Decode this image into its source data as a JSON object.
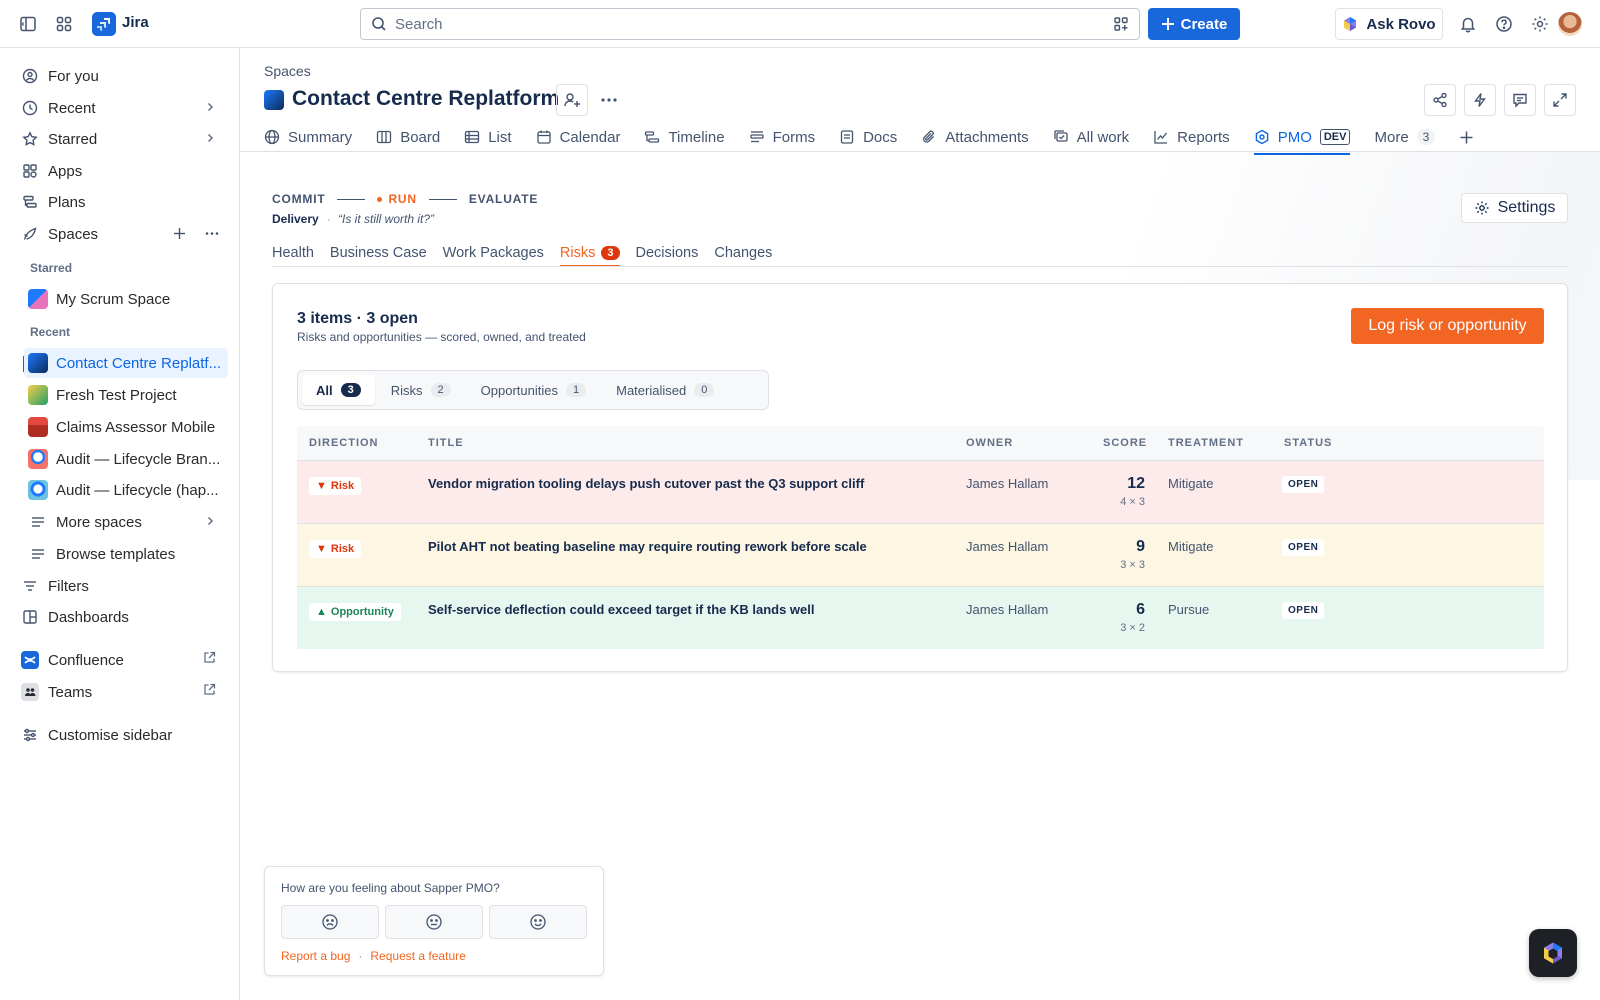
{
  "topbar": {
    "app_name": "Jira",
    "search_placeholder": "Search",
    "create_label": "Create",
    "ask_rovo_label": "Ask Rovo"
  },
  "sidebar": {
    "items": [
      {
        "label": "For you",
        "icon": "person-circle-icon"
      },
      {
        "label": "Recent",
        "icon": "clock-icon"
      },
      {
        "label": "Starred",
        "icon": "star-icon"
      },
      {
        "label": "Apps",
        "icon": "apps-icon"
      },
      {
        "label": "Plans",
        "icon": "plans-icon"
      },
      {
        "label": "Spaces",
        "icon": "spaces-icon"
      }
    ],
    "starred_heading": "Starred",
    "starred": [
      {
        "label": "My Scrum Space"
      }
    ],
    "recent_heading": "Recent",
    "recent": [
      {
        "label": "Contact Centre Replatf..."
      },
      {
        "label": "Fresh Test Project"
      },
      {
        "label": "Claims Assessor Mobile"
      },
      {
        "label": "Audit — Lifecycle Bran..."
      },
      {
        "label": "Audit — Lifecycle (hap..."
      }
    ],
    "more_spaces": "More spaces",
    "browse_templates": "Browse templates",
    "filters": "Filters",
    "dashboards": "Dashboards",
    "confluence": "Confluence",
    "teams": "Teams",
    "customise": "Customise sidebar"
  },
  "header": {
    "breadcrumb": "Spaces",
    "title": "Contact Centre Replatform"
  },
  "tabs": [
    {
      "label": "Summary",
      "icon": "globe-icon"
    },
    {
      "label": "Board",
      "icon": "board-icon"
    },
    {
      "label": "List",
      "icon": "list-icon"
    },
    {
      "label": "Calendar",
      "icon": "calendar-icon"
    },
    {
      "label": "Timeline",
      "icon": "timeline-icon"
    },
    {
      "label": "Forms",
      "icon": "forms-icon"
    },
    {
      "label": "Docs",
      "icon": "docs-icon"
    },
    {
      "label": "Attachments",
      "icon": "paperclip-icon"
    },
    {
      "label": "All work",
      "icon": "all-work-icon"
    },
    {
      "label": "Reports",
      "icon": "chart-line-icon"
    },
    {
      "label": "PMO",
      "icon": "pmo-hex-icon",
      "badge": "DEV"
    }
  ],
  "more_tab": {
    "label": "More",
    "count": "3"
  },
  "pmo": {
    "stages": [
      "COMMIT",
      "RUN",
      "EVALUATE"
    ],
    "active_stage": "RUN",
    "phase_label": "Delivery",
    "phase_question": "“Is it still worth it?”",
    "settings_label": "Settings",
    "subtabs": [
      {
        "label": "Health"
      },
      {
        "label": "Business Case"
      },
      {
        "label": "Work Packages"
      },
      {
        "label": "Risks",
        "count": "3"
      },
      {
        "label": "Decisions"
      },
      {
        "label": "Changes"
      }
    ]
  },
  "risks": {
    "summary": "3 items · 3 open",
    "subtitle": "Risks and opportunities — scored, owned, and treated",
    "log_button": "Log risk or opportunity",
    "filters": [
      {
        "label": "All",
        "count": "3"
      },
      {
        "label": "Risks",
        "count": "2"
      },
      {
        "label": "Opportunities",
        "count": "1"
      },
      {
        "label": "Materialised",
        "count": "0"
      }
    ],
    "columns": [
      "DIRECTION",
      "TITLE",
      "OWNER",
      "SCORE",
      "TREATMENT",
      "STATUS"
    ],
    "rows": [
      {
        "direction": "Risk",
        "arrow": "▼",
        "title": "Vendor migration tooling delays push cutover past the Q3 support cliff",
        "owner": "James Hallam",
        "score": "12",
        "calc": "4 × 3",
        "treatment": "Mitigate",
        "status": "OPEN"
      },
      {
        "direction": "Risk",
        "arrow": "▼",
        "title": "Pilot AHT not beating baseline may require routing rework before scale",
        "owner": "James Hallam",
        "score": "9",
        "calc": "3 × 3",
        "treatment": "Mitigate",
        "status": "OPEN"
      },
      {
        "direction": "Opportunity",
        "arrow": "▲",
        "title": "Self-service deflection could exceed target if the KB lands well",
        "owner": "James Hallam",
        "score": "6",
        "calc": "3 × 2",
        "treatment": "Pursue",
        "status": "OPEN"
      }
    ]
  },
  "feedback": {
    "question": "How are you feeling about Sapper PMO?",
    "report_bug": "Report a bug",
    "separator": "·",
    "request_feature": "Request a feature"
  },
  "colors": {
    "accent_blue": "#1868db",
    "pmo_orange": "#f26522",
    "risk_red": "#de350b",
    "opportunity_green": "#1f845a"
  }
}
